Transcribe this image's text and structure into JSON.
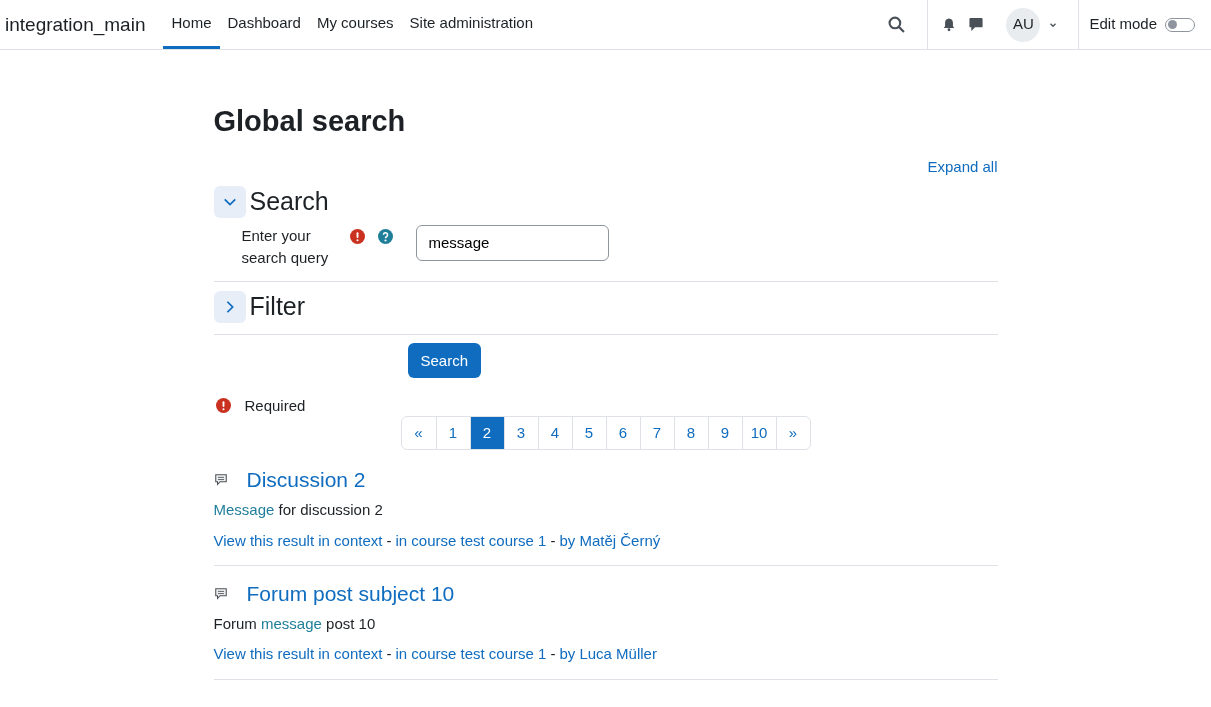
{
  "navbar": {
    "site_name": "integration_main",
    "items": [
      {
        "label": "Home",
        "selected": true
      },
      {
        "label": "Dashboard",
        "selected": false
      },
      {
        "label": "My courses",
        "selected": false
      },
      {
        "label": "Site administration",
        "selected": false
      }
    ],
    "user_initials": "AU",
    "edit_mode": {
      "label": "Edit mode",
      "on": false
    }
  },
  "page_title": "Global search",
  "expand_all": "Expand all",
  "sections": [
    {
      "title": "Search",
      "expanded": true,
      "field": {
        "label": "Enter your search query",
        "value": "message"
      }
    },
    {
      "title": "Filter",
      "expanded": false
    }
  ],
  "submit_button": "Search",
  "required_note": "Required",
  "pagination": [
    {
      "label": "«",
      "selected": false
    },
    {
      "label": "1",
      "selected": false
    },
    {
      "label": "2",
      "selected": true
    },
    {
      "label": "3",
      "selected": false
    },
    {
      "label": "4",
      "selected": false
    },
    {
      "label": "5",
      "selected": false
    },
    {
      "label": "6",
      "selected": false
    },
    {
      "label": "7",
      "selected": false
    },
    {
      "label": "8",
      "selected": false
    },
    {
      "label": "9",
      "selected": false
    },
    {
      "label": "10",
      "selected": false
    },
    {
      "label": "»",
      "selected": false
    }
  ],
  "results": [
    {
      "title": "Discussion 2",
      "snippet": [
        {
          "text": "Message",
          "highlight": true
        },
        {
          "text": " for discussion 2",
          "highlight": false
        }
      ],
      "context": [
        {
          "text": "View this result in context",
          "kind": "link"
        },
        {
          "text": "-",
          "kind": "separator"
        },
        {
          "text": "in course test course 1",
          "kind": "link"
        },
        {
          "text": "-",
          "kind": "separator"
        },
        {
          "text": "by Matěj Černý",
          "kind": "link"
        }
      ]
    },
    {
      "title": "Forum post subject 10",
      "snippet": [
        {
          "text": "Forum ",
          "highlight": false
        },
        {
          "text": "message",
          "highlight": true
        },
        {
          "text": " post 10",
          "highlight": false
        }
      ],
      "context": [
        {
          "text": "View this result in context",
          "kind": "link"
        },
        {
          "text": "-",
          "kind": "separator"
        },
        {
          "text": "in course test course 1",
          "kind": "link"
        },
        {
          "text": "-",
          "kind": "separator"
        },
        {
          "text": "by Luca Müller",
          "kind": "link"
        }
      ]
    }
  ]
}
